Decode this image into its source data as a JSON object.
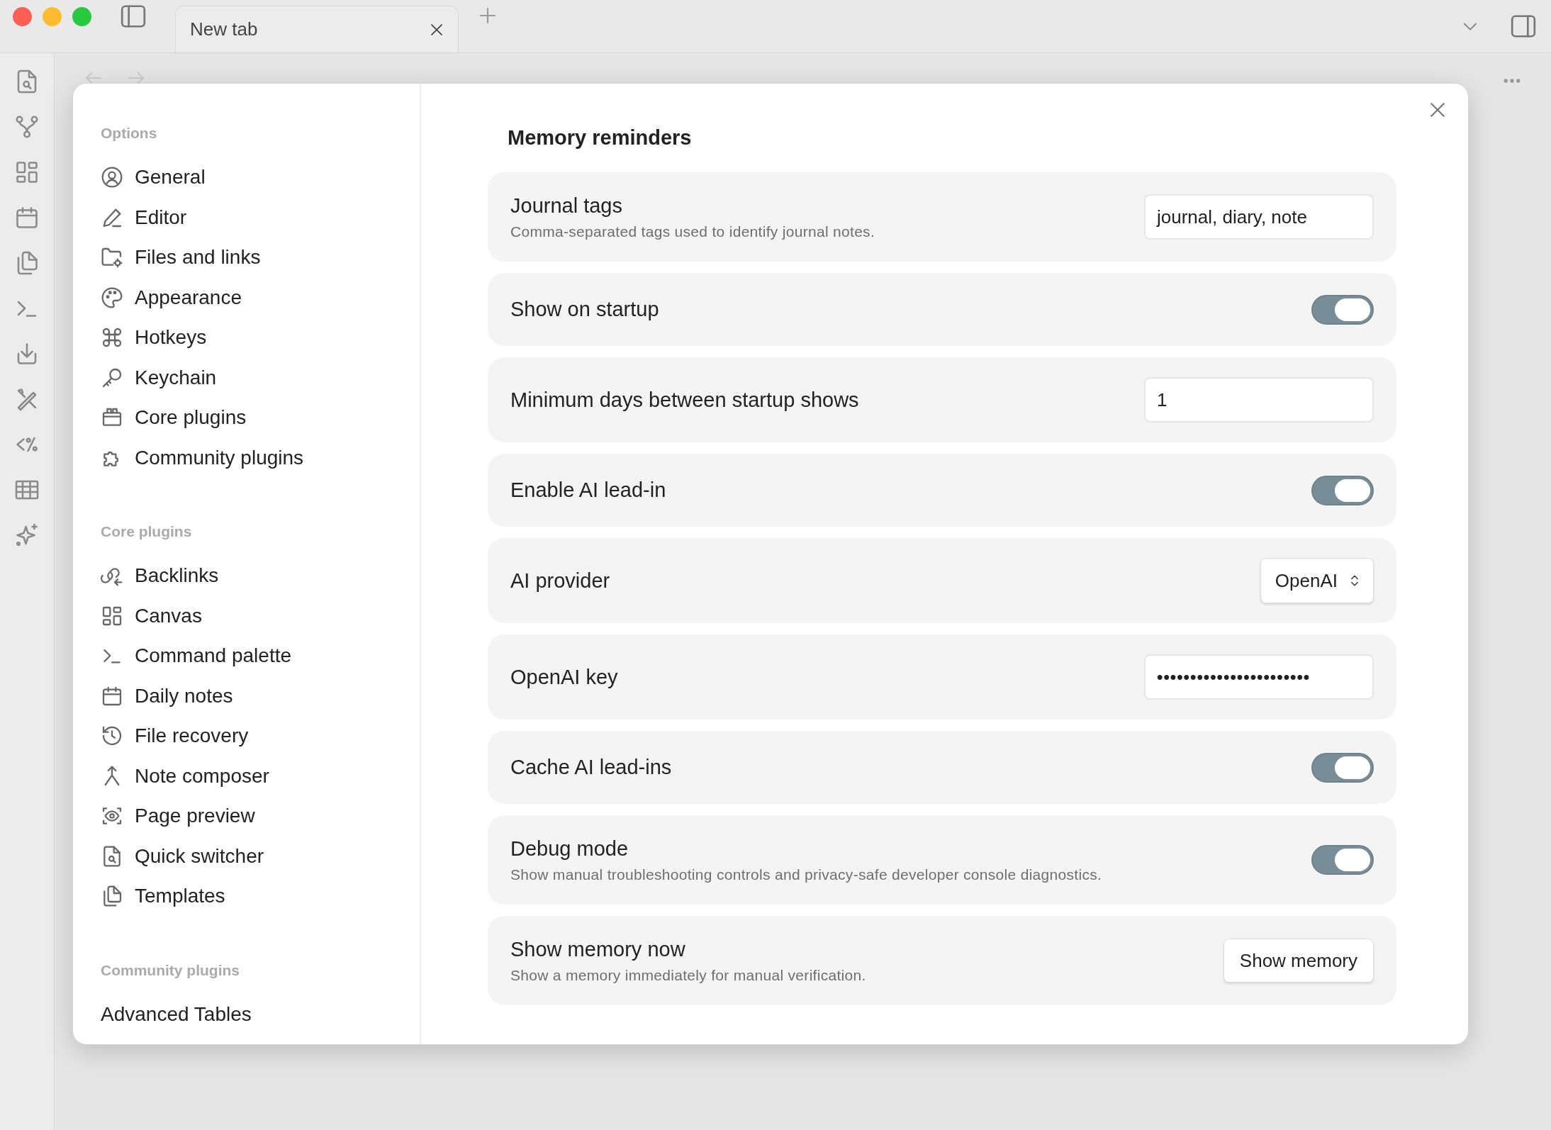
{
  "tabs": [
    {
      "label": "New tab",
      "selected": true
    }
  ],
  "sidebar": {
    "sections": [
      {
        "title": "Options",
        "items": [
          {
            "label": "General"
          },
          {
            "label": "Editor"
          },
          {
            "label": "Files and links"
          },
          {
            "label": "Appearance"
          },
          {
            "label": "Hotkeys"
          },
          {
            "label": "Keychain"
          },
          {
            "label": "Core plugins"
          },
          {
            "label": "Community plugins"
          }
        ]
      },
      {
        "title": "Core plugins",
        "items": [
          {
            "label": "Backlinks"
          },
          {
            "label": "Canvas"
          },
          {
            "label": "Command palette"
          },
          {
            "label": "Daily notes"
          },
          {
            "label": "File recovery"
          },
          {
            "label": "Note composer"
          },
          {
            "label": "Page preview"
          },
          {
            "label": "Quick switcher"
          },
          {
            "label": "Templates"
          }
        ]
      },
      {
        "title": "Community plugins",
        "items": [
          {
            "label": "Advanced Tables"
          }
        ]
      }
    ]
  },
  "settings": {
    "title": "Memory reminders",
    "items": [
      {
        "kind": "text",
        "name": "Journal tags",
        "description": "Comma-separated tags used to identify journal notes.",
        "value": "journal, diary, note"
      },
      {
        "kind": "toggle",
        "name": "Show on startup",
        "on": true
      },
      {
        "kind": "text",
        "name": "Minimum days between startup shows",
        "value": "1"
      },
      {
        "kind": "toggle",
        "name": "Enable AI lead-in",
        "on": true
      },
      {
        "kind": "select",
        "name": "AI provider",
        "value": "OpenAI"
      },
      {
        "kind": "password",
        "name": "OpenAI key",
        "value": "•••••••••••••••••••••••"
      },
      {
        "kind": "toggle",
        "name": "Cache AI lead-ins",
        "on": true
      },
      {
        "kind": "toggle",
        "name": "Debug mode",
        "description": "Show manual troubleshooting controls and privacy-safe developer console diagnostics.",
        "on": true
      },
      {
        "kind": "button",
        "name": "Show memory now",
        "description": "Show a memory immediately for manual verification.",
        "label": "Show memory"
      }
    ]
  }
}
